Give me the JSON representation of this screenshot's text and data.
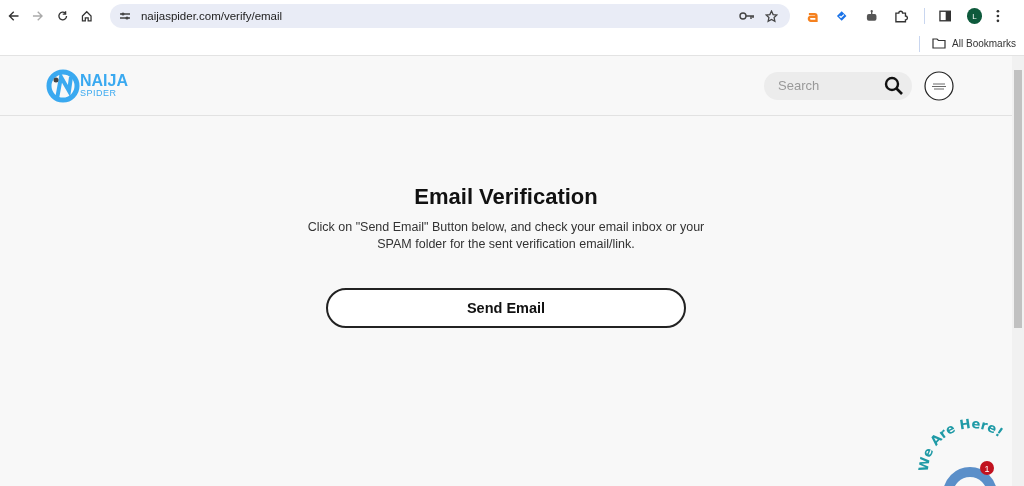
{
  "browser": {
    "url": "naijaspider.com/verify/email",
    "profile_initial": "L",
    "bookmarks_label": "All Bookmarks"
  },
  "header": {
    "logo_top": "NAIJA",
    "logo_bottom": "SPIDER",
    "search": {
      "placeholder": "Search"
    }
  },
  "main": {
    "title": "Email Verification",
    "text": "Click on \"Send Email\" Button below, and check your email inbox or your SPAM folder for the sent verification email/link.",
    "button": "Send Email"
  },
  "chat_widget": {
    "caption": "We Are Here!",
    "badge": "1"
  }
}
